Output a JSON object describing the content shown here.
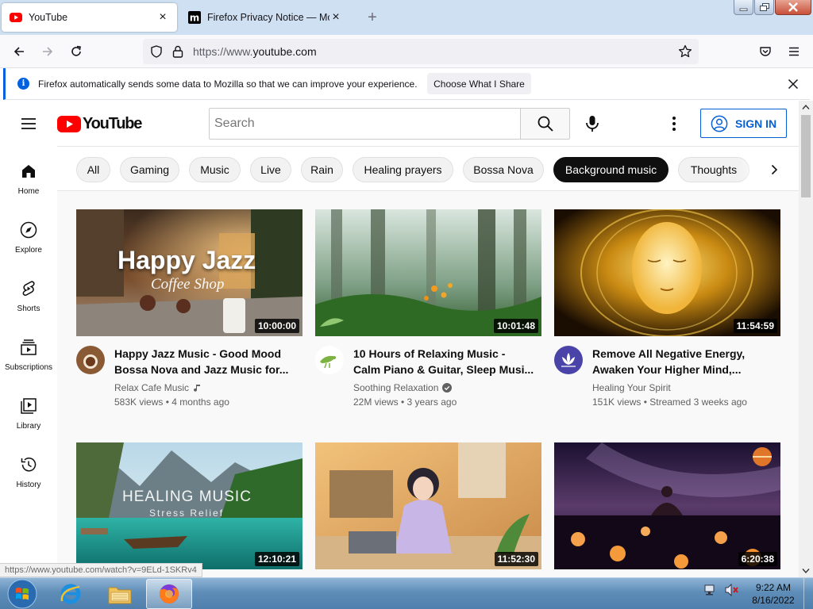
{
  "browser": {
    "tabs": [
      {
        "title": "YouTube",
        "active": true
      },
      {
        "title": "Firefox Privacy Notice — Mozilla",
        "active": false
      }
    ],
    "url": {
      "scheme": "https://www.",
      "host": "youtube.com"
    },
    "notification": {
      "message": "Firefox automatically sends some data to Mozilla so that we can improve your experience.",
      "button": "Choose What I Share"
    },
    "status_link": "https://www.youtube.com/watch?v=9ELd-1SKRv4"
  },
  "youtube": {
    "logo_text": "YouTube",
    "search_placeholder": "Search",
    "signin_label": "SIGN IN",
    "sidebar": [
      {
        "label": "Home",
        "icon": "home-icon"
      },
      {
        "label": "Explore",
        "icon": "compass-icon"
      },
      {
        "label": "Shorts",
        "icon": "shorts-icon"
      },
      {
        "label": "Subscriptions",
        "icon": "subscriptions-icon"
      },
      {
        "label": "Library",
        "icon": "library-icon"
      },
      {
        "label": "History",
        "icon": "history-icon"
      }
    ],
    "chips": [
      {
        "label": "All"
      },
      {
        "label": "Gaming"
      },
      {
        "label": "Music"
      },
      {
        "label": "Live"
      },
      {
        "label": "Rain"
      },
      {
        "label": "Healing prayers"
      },
      {
        "label": "Bossa Nova"
      },
      {
        "label": "Background music",
        "selected": true
      },
      {
        "label": "Thoughts"
      }
    ],
    "videos": [
      {
        "title_line1": "Happy Jazz Music - Good Mood",
        "title_line2": "Bossa Nova and Jazz Music for...",
        "channel": "Relax Cafe Music",
        "badge": "music-note-icon",
        "stats": "583K views • 4 months ago",
        "duration": "10:00:00",
        "thumb_title": "Happy Jazz",
        "thumb_sub": "Coffee Shop"
      },
      {
        "title_line1": "10 Hours of Relaxing Music -",
        "title_line2": "Calm Piano & Guitar, Sleep Musi...",
        "channel": "Soothing Relaxation",
        "badge": "verified-check-icon",
        "stats": "22M views • 3 years ago",
        "duration": "10:01:48"
      },
      {
        "title_line1": "Remove All Negative Energy,",
        "title_line2": "Awaken Your Higher Mind,...",
        "channel": "Healing Your Spirit",
        "stats": "151K views • Streamed 3 weeks ago",
        "duration": "11:54:59"
      },
      {
        "duration": "12:10:21",
        "thumb_title": "HEALING MUSIC",
        "thumb_sub": "Stress Relief"
      },
      {
        "duration": "11:52:30"
      },
      {
        "duration": "6:20:38"
      }
    ]
  },
  "taskbar": {
    "apps": [
      "internet-explorer-icon",
      "file-explorer-icon",
      "firefox-icon"
    ],
    "time": "9:22 AM",
    "date": "8/16/2022"
  },
  "colors": {
    "youtube_red": "#ff0000",
    "link_blue": "#065fd4",
    "firefox_accent": "#0060df"
  }
}
